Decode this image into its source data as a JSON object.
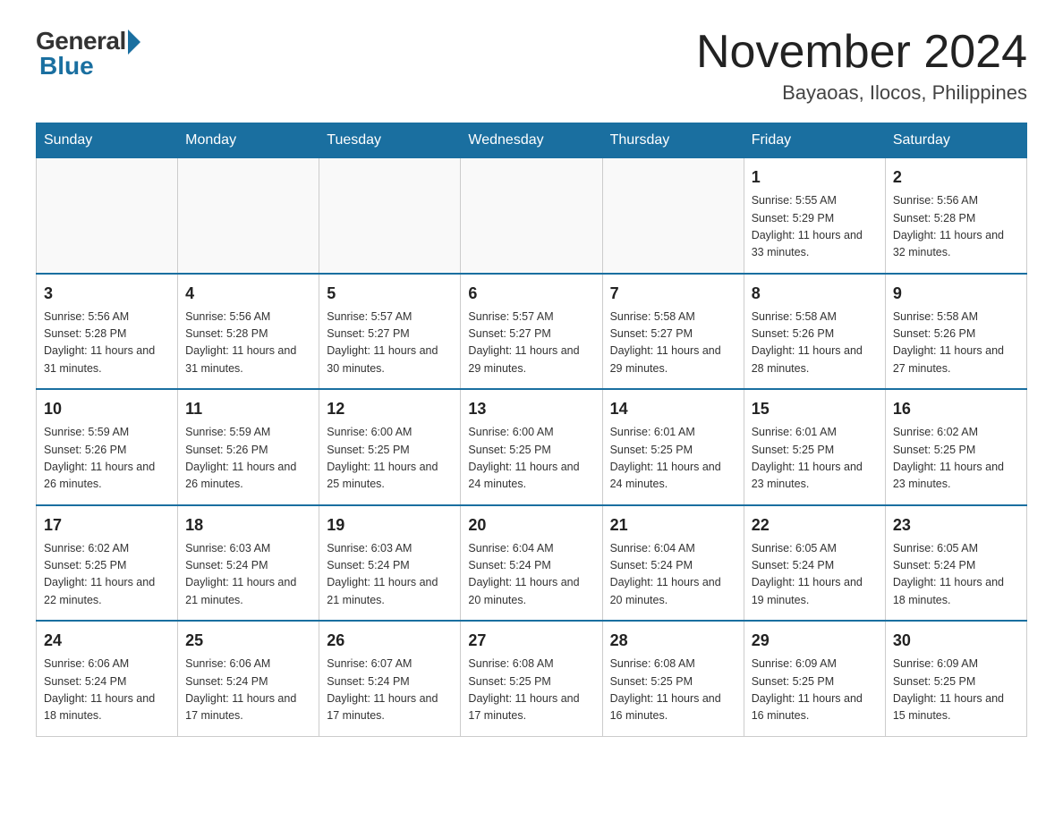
{
  "header": {
    "logo_general": "General",
    "logo_blue": "Blue",
    "month_title": "November 2024",
    "location": "Bayaoas, Ilocos, Philippines"
  },
  "weekdays": [
    "Sunday",
    "Monday",
    "Tuesday",
    "Wednesday",
    "Thursday",
    "Friday",
    "Saturday"
  ],
  "weeks": [
    [
      {
        "day": "",
        "info": ""
      },
      {
        "day": "",
        "info": ""
      },
      {
        "day": "",
        "info": ""
      },
      {
        "day": "",
        "info": ""
      },
      {
        "day": "",
        "info": ""
      },
      {
        "day": "1",
        "info": "Sunrise: 5:55 AM\nSunset: 5:29 PM\nDaylight: 11 hours and 33 minutes."
      },
      {
        "day": "2",
        "info": "Sunrise: 5:56 AM\nSunset: 5:28 PM\nDaylight: 11 hours and 32 minutes."
      }
    ],
    [
      {
        "day": "3",
        "info": "Sunrise: 5:56 AM\nSunset: 5:28 PM\nDaylight: 11 hours and 31 minutes."
      },
      {
        "day": "4",
        "info": "Sunrise: 5:56 AM\nSunset: 5:28 PM\nDaylight: 11 hours and 31 minutes."
      },
      {
        "day": "5",
        "info": "Sunrise: 5:57 AM\nSunset: 5:27 PM\nDaylight: 11 hours and 30 minutes."
      },
      {
        "day": "6",
        "info": "Sunrise: 5:57 AM\nSunset: 5:27 PM\nDaylight: 11 hours and 29 minutes."
      },
      {
        "day": "7",
        "info": "Sunrise: 5:58 AM\nSunset: 5:27 PM\nDaylight: 11 hours and 29 minutes."
      },
      {
        "day": "8",
        "info": "Sunrise: 5:58 AM\nSunset: 5:26 PM\nDaylight: 11 hours and 28 minutes."
      },
      {
        "day": "9",
        "info": "Sunrise: 5:58 AM\nSunset: 5:26 PM\nDaylight: 11 hours and 27 minutes."
      }
    ],
    [
      {
        "day": "10",
        "info": "Sunrise: 5:59 AM\nSunset: 5:26 PM\nDaylight: 11 hours and 26 minutes."
      },
      {
        "day": "11",
        "info": "Sunrise: 5:59 AM\nSunset: 5:26 PM\nDaylight: 11 hours and 26 minutes."
      },
      {
        "day": "12",
        "info": "Sunrise: 6:00 AM\nSunset: 5:25 PM\nDaylight: 11 hours and 25 minutes."
      },
      {
        "day": "13",
        "info": "Sunrise: 6:00 AM\nSunset: 5:25 PM\nDaylight: 11 hours and 24 minutes."
      },
      {
        "day": "14",
        "info": "Sunrise: 6:01 AM\nSunset: 5:25 PM\nDaylight: 11 hours and 24 minutes."
      },
      {
        "day": "15",
        "info": "Sunrise: 6:01 AM\nSunset: 5:25 PM\nDaylight: 11 hours and 23 minutes."
      },
      {
        "day": "16",
        "info": "Sunrise: 6:02 AM\nSunset: 5:25 PM\nDaylight: 11 hours and 23 minutes."
      }
    ],
    [
      {
        "day": "17",
        "info": "Sunrise: 6:02 AM\nSunset: 5:25 PM\nDaylight: 11 hours and 22 minutes."
      },
      {
        "day": "18",
        "info": "Sunrise: 6:03 AM\nSunset: 5:24 PM\nDaylight: 11 hours and 21 minutes."
      },
      {
        "day": "19",
        "info": "Sunrise: 6:03 AM\nSunset: 5:24 PM\nDaylight: 11 hours and 21 minutes."
      },
      {
        "day": "20",
        "info": "Sunrise: 6:04 AM\nSunset: 5:24 PM\nDaylight: 11 hours and 20 minutes."
      },
      {
        "day": "21",
        "info": "Sunrise: 6:04 AM\nSunset: 5:24 PM\nDaylight: 11 hours and 20 minutes."
      },
      {
        "day": "22",
        "info": "Sunrise: 6:05 AM\nSunset: 5:24 PM\nDaylight: 11 hours and 19 minutes."
      },
      {
        "day": "23",
        "info": "Sunrise: 6:05 AM\nSunset: 5:24 PM\nDaylight: 11 hours and 18 minutes."
      }
    ],
    [
      {
        "day": "24",
        "info": "Sunrise: 6:06 AM\nSunset: 5:24 PM\nDaylight: 11 hours and 18 minutes."
      },
      {
        "day": "25",
        "info": "Sunrise: 6:06 AM\nSunset: 5:24 PM\nDaylight: 11 hours and 17 minutes."
      },
      {
        "day": "26",
        "info": "Sunrise: 6:07 AM\nSunset: 5:24 PM\nDaylight: 11 hours and 17 minutes."
      },
      {
        "day": "27",
        "info": "Sunrise: 6:08 AM\nSunset: 5:25 PM\nDaylight: 11 hours and 17 minutes."
      },
      {
        "day": "28",
        "info": "Sunrise: 6:08 AM\nSunset: 5:25 PM\nDaylight: 11 hours and 16 minutes."
      },
      {
        "day": "29",
        "info": "Sunrise: 6:09 AM\nSunset: 5:25 PM\nDaylight: 11 hours and 16 minutes."
      },
      {
        "day": "30",
        "info": "Sunrise: 6:09 AM\nSunset: 5:25 PM\nDaylight: 11 hours and 15 minutes."
      }
    ]
  ]
}
